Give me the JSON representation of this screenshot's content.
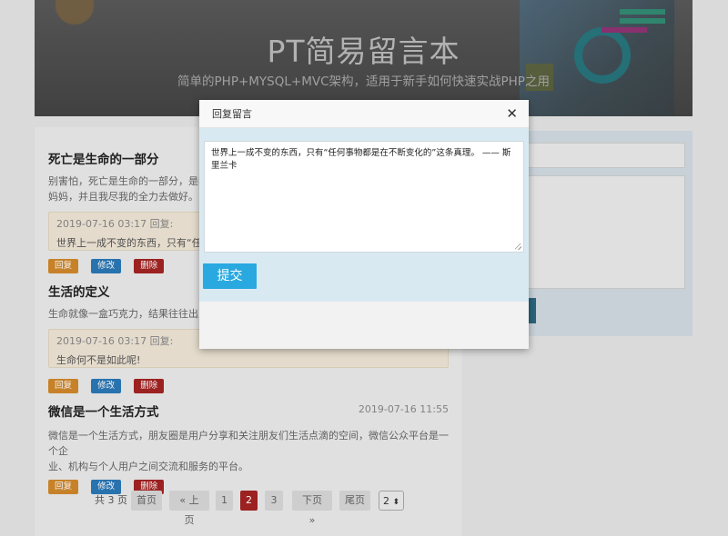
{
  "banner": {
    "title": "PT简易留言本",
    "subtitle": "简单的PHP+MYSQL+MVC架构，适用于新手如何快速实战PHP之用"
  },
  "messages": [
    {
      "title": "死亡是生命的一部分",
      "time": "",
      "body": "别害怕，死亡是生命的一部分，是我们",
      "body2": "妈妈，并且我尽我的全力去做好。",
      "reply_meta": "2019-07-16 03:17 回复:",
      "reply_text": "世界上一成不变的东西，只有“任何",
      "buttons": [
        "回复",
        "修改",
        "删除"
      ]
    },
    {
      "title": "生活的定义",
      "time": "",
      "body": "生命就像一盒巧克力，结果往往出人意",
      "reply_meta": "2019-07-16 03:17 回复:",
      "reply_text": "生命何不是如此呢!",
      "buttons": [
        "回复",
        "修改",
        "删除"
      ]
    },
    {
      "title": "微信是一个生活方式",
      "time": "2019-07-16 11:55",
      "body": "微信是一个生活方式，朋友圈是用户分享和关注朋友们生活点滴的空间，微信公众平台是一个企",
      "body2": "业、机构与个人用户之间交流和服务的平台。",
      "buttons": [
        "回复",
        "修改",
        "删除"
      ]
    }
  ],
  "pagination": {
    "total": "共 3 页",
    "first": "首页",
    "prev": "« 上页",
    "pages": [
      "1",
      "2",
      "3"
    ],
    "current_page": "2",
    "next": "下页 »",
    "last": "尾页",
    "select_value": "2",
    "select_arrow": "⬍"
  },
  "modal": {
    "title": "回复留言",
    "close": "✕",
    "textarea_value": "世界上一成不变的东西，只有“任何事物都是在不断变化的”这条真理。 —— 斯里兰卡",
    "submit": "提交"
  }
}
